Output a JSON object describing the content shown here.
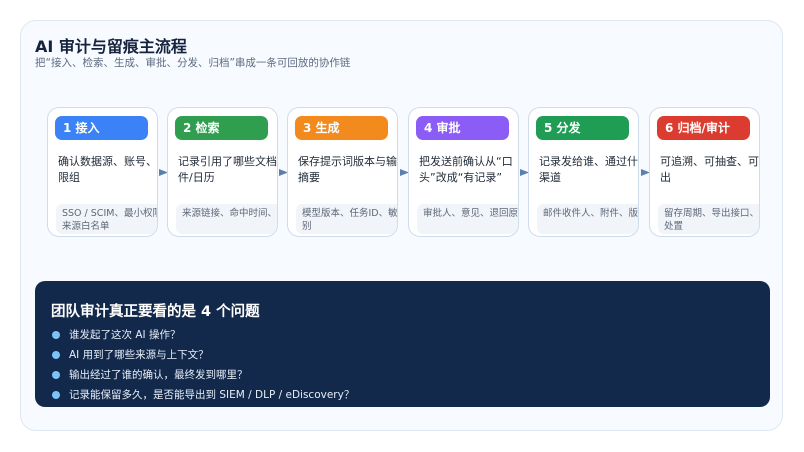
{
  "header": {
    "title": "AI 审计与留痕主流程",
    "subtitle": "把“接入、检索、生成、审批、分发、归档”串成一条可回放的协作链"
  },
  "steps": [
    {
      "label": "1 接入",
      "color": "#3b82f6",
      "desc": "确认数据源、账号、权限组",
      "detail": "SSO / SCIM、最小权限、来源白名单"
    },
    {
      "label": "2 检索",
      "color": "#2f9e4f",
      "desc": "记录引用了哪些文档/邮件/日历",
      "detail": "来源链接、命中时间、仅人"
    },
    {
      "label": "3 生成",
      "color": "#f28a1e",
      "desc": "保存提示词版本与输出摘要",
      "detail": "模型版本、任务ID、敏感级别"
    },
    {
      "label": "4 审批",
      "color": "#8b5cf6",
      "desc": "把发送前确认从“口头”改成“有记录”",
      "detail": "审批人、意见、退回原因"
    },
    {
      "label": "5 分发",
      "color": "#1f9d55",
      "desc": "记录发给谁、通过什么渠道",
      "detail": "邮件收件人、附件、版本"
    },
    {
      "label": "6 归档/审计",
      "color": "#dc3c2f",
      "desc": "可追溯、可抽查、可导出",
      "detail": "留存周期、导出接口、例外处置"
    }
  ],
  "arrow_color": "#5d7fb0",
  "questions_panel": {
    "title": "团队审计真正要看的是 4 个问题",
    "questions": [
      "谁发起了这次 AI 操作？",
      "AI 用到了哪些来源与上下文？",
      "输出经过了谁的确认，最终发到哪里？",
      "记录能保留多久，是否能导出到 SIEM / DLP / eDiscovery？"
    ]
  }
}
